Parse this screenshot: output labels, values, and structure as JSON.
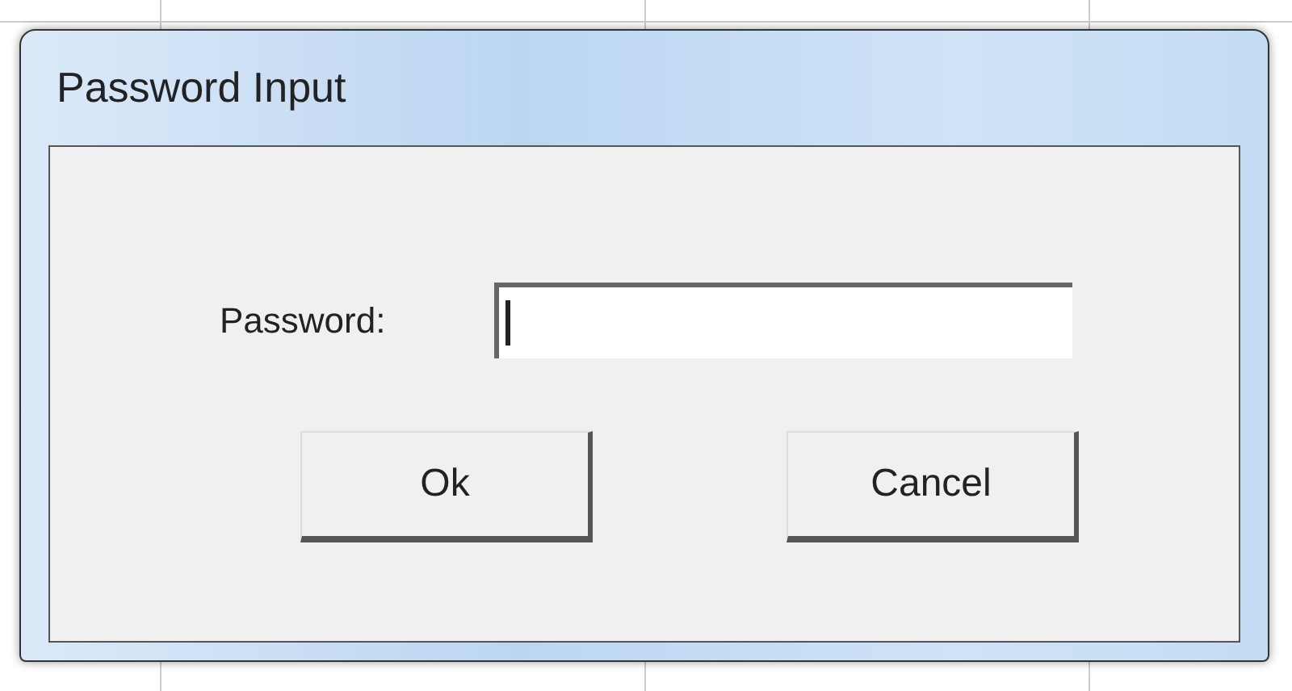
{
  "window": {
    "title": "Password Input"
  },
  "password_field": {
    "label": "Password:",
    "focused": true
  },
  "buttons": [
    {
      "label": "Ok"
    },
    {
      "label": "Cancel"
    }
  ]
}
